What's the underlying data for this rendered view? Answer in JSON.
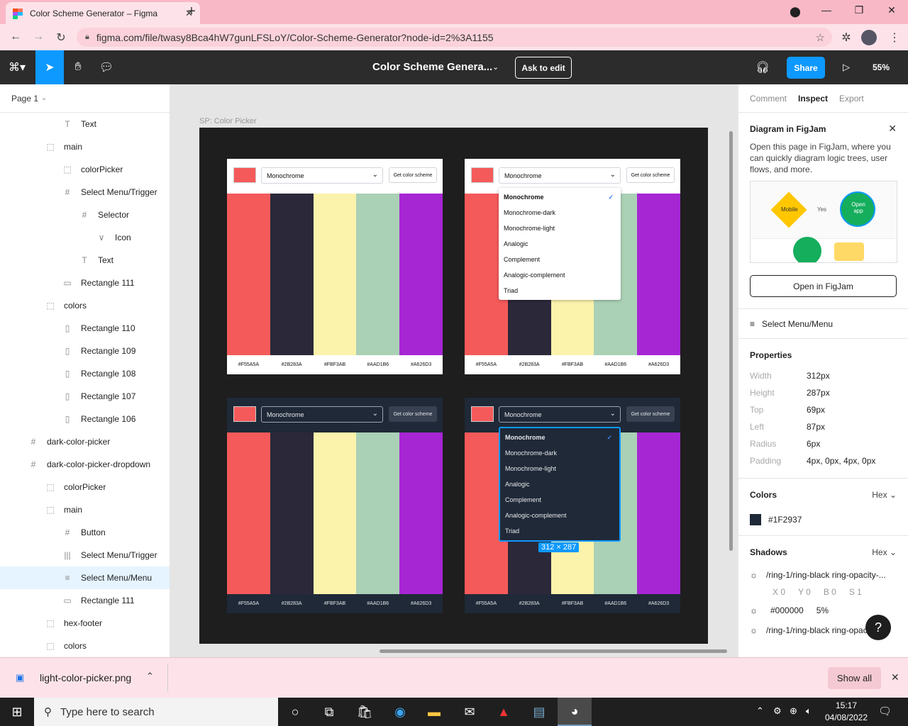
{
  "browser": {
    "tab_title": "Color Scheme Generator – Figma",
    "url": "figma.com/file/twasy8Bca4hW7gunLFSLoY/Color-Scheme-Generator?node-id=2%3A1155"
  },
  "figma_toolbar": {
    "file_title": "Color Scheme Genera...",
    "ask_to_edit": "Ask to edit",
    "share": "Share",
    "zoom": "55%"
  },
  "left_panel": {
    "page": "Page 1",
    "layers": [
      {
        "name": "Text",
        "icon": "T",
        "indent": 3
      },
      {
        "name": "main",
        "icon": "⬚",
        "indent": 2
      },
      {
        "name": "colorPicker",
        "icon": "⬚",
        "indent": 3
      },
      {
        "name": "Select Menu/Trigger",
        "icon": "#",
        "indent": 3
      },
      {
        "name": "Selector",
        "icon": "#",
        "indent": 4
      },
      {
        "name": "Icon",
        "icon": "∨",
        "indent": 5
      },
      {
        "name": "Text",
        "icon": "T",
        "indent": 4
      },
      {
        "name": "Rectangle 111",
        "icon": "▭",
        "indent": 3
      },
      {
        "name": "colors",
        "icon": "⬚",
        "indent": 2
      },
      {
        "name": "Rectangle 110",
        "icon": "▯",
        "indent": 3
      },
      {
        "name": "Rectangle 109",
        "icon": "▯",
        "indent": 3
      },
      {
        "name": "Rectangle 108",
        "icon": "▯",
        "indent": 3
      },
      {
        "name": "Rectangle 107",
        "icon": "▯",
        "indent": 3
      },
      {
        "name": "Rectangle 106",
        "icon": "▯",
        "indent": 3
      },
      {
        "name": "dark-color-picker",
        "icon": "#",
        "indent": 1
      },
      {
        "name": "dark-color-picker-dropdown",
        "icon": "#",
        "indent": 1
      },
      {
        "name": "colorPicker",
        "icon": "⬚",
        "indent": 2
      },
      {
        "name": "main",
        "icon": "⬚",
        "indent": 2
      },
      {
        "name": "Button",
        "icon": "#",
        "indent": 3
      },
      {
        "name": "Select Menu/Trigger",
        "icon": "|||",
        "indent": 3
      },
      {
        "name": "Select Menu/Menu",
        "icon": "≡",
        "indent": 3,
        "selected": true
      },
      {
        "name": "Rectangle 111",
        "icon": "▭",
        "indent": 3
      },
      {
        "name": "hex-footer",
        "icon": "⬚",
        "indent": 2
      },
      {
        "name": "colors",
        "icon": "⬚",
        "indent": 2
      }
    ]
  },
  "canvas": {
    "frame_label": "SP: Color Picker",
    "select_value": "Monochrome",
    "button_label": "Get color scheme",
    "colors": [
      "#F55A5A",
      "#2B283A",
      "#FBF3AB",
      "#AAD1B6",
      "#A626D3"
    ],
    "menu_options": [
      "Monochrome",
      "Monochrome-dark",
      "Monochrome-light",
      "Analogic",
      "Complement",
      "Analogic-complement",
      "Triad"
    ],
    "size_badge": "312 × 287"
  },
  "right_panel": {
    "tabs": [
      "Comment",
      "Inspect",
      "Export"
    ],
    "active_tab": "Inspect",
    "banner": {
      "title": "Diagram in FigJam",
      "text": "Open this page in FigJam, where you can quickly diagram logic trees, user flows, and more.",
      "mobile": "Mobile",
      "yes": "Yes",
      "open_app": "Open app",
      "button": "Open in FigJam"
    },
    "component_name": "Select Menu/Menu",
    "properties_title": "Properties",
    "properties": [
      {
        "k": "Width",
        "v": "312px"
      },
      {
        "k": "Height",
        "v": "287px"
      },
      {
        "k": "Top",
        "v": "69px"
      },
      {
        "k": "Left",
        "v": "87px"
      },
      {
        "k": "Radius",
        "v": "6px"
      },
      {
        "k": "Padding",
        "v": "4px, 0px, 4px, 0px"
      }
    ],
    "colors_title": "Colors",
    "format": "Hex",
    "color_value": "#1F2937",
    "shadows_title": "Shadows",
    "shadow1_name": "/ring-1/ring-black ring-opacity-...",
    "shadow1_xy": [
      "X 0",
      "Y 0",
      "B 0",
      "S 1"
    ],
    "shadow1_color": "#000000",
    "shadow1_opacity": "5%",
    "shadow2_name": "/ring-1/ring-black ring-opacity-..."
  },
  "download_bar": {
    "file": "light-color-picker.png",
    "show_all": "Show all"
  },
  "taskbar": {
    "search_placeholder": "Type here to search",
    "time": "15:17",
    "date": "04/08/2022"
  }
}
